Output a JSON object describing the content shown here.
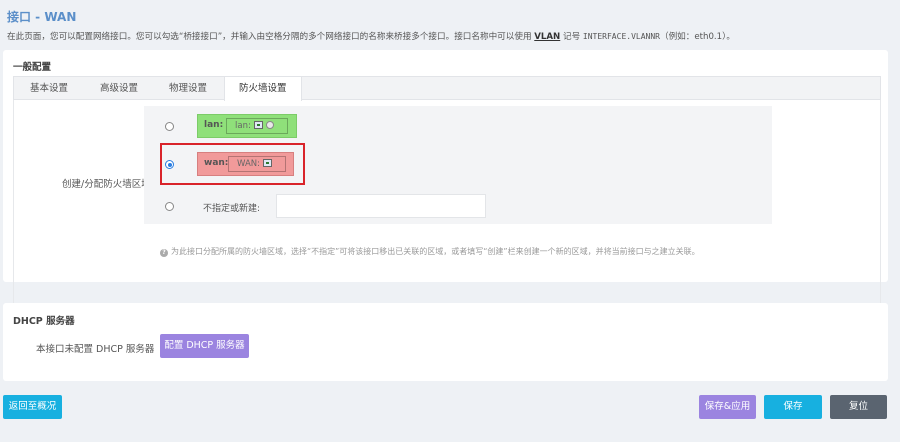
{
  "page": {
    "title": "接口 - WAN",
    "desc_prefix": "在此页面，您可以配置网络接口。您可以勾选“桥接接口”，并输入由空格分隔的多个网络接口的名称来桥接多个接口。接口名称中可以使用 ",
    "desc_vlan": "VLAN",
    "desc_middle": " 记号 ",
    "desc_code": "INTERFACE.VLANNR",
    "desc_suffix": "（例如：eth0.1）。"
  },
  "general": {
    "section_title": "一般配置",
    "tabs": [
      {
        "label": "基本设置"
      },
      {
        "label": "高级设置"
      },
      {
        "label": "物理设置"
      },
      {
        "label": "防火墙设置"
      }
    ],
    "field_label": "创建/分配防火墙区域",
    "zones": [
      {
        "name": "lan:",
        "iface": "lan:",
        "selected": false,
        "color": "#8fe07a"
      },
      {
        "name": "wan:",
        "iface": "WAN:",
        "selected": true,
        "color": "#f19a9a"
      }
    ],
    "new_zone_label": "不指定或新建:",
    "new_zone_value": "",
    "hint": "为此接口分配所属的防火墙区域，选择“不指定”可将该接口移出已关联的区域，或者填写“创建”栏来创建一个新的区域，并将当前接口与之建立关联。"
  },
  "dhcp": {
    "section_title": "DHCP 服务器",
    "status_label": "本接口未配置 DHCP 服务器",
    "config_button": "配置 DHCP 服务器"
  },
  "footer": {
    "back_button": "返回至概况",
    "save_apply_button": "保存&应用",
    "save_button": "保存",
    "reset_button": "复位"
  },
  "colors": {
    "title": "#5b8fc9",
    "purple_button": "#9b84e0",
    "teal_button": "#17b0e0",
    "gray_button": "#5a6470",
    "highlight": "#d9232a"
  }
}
